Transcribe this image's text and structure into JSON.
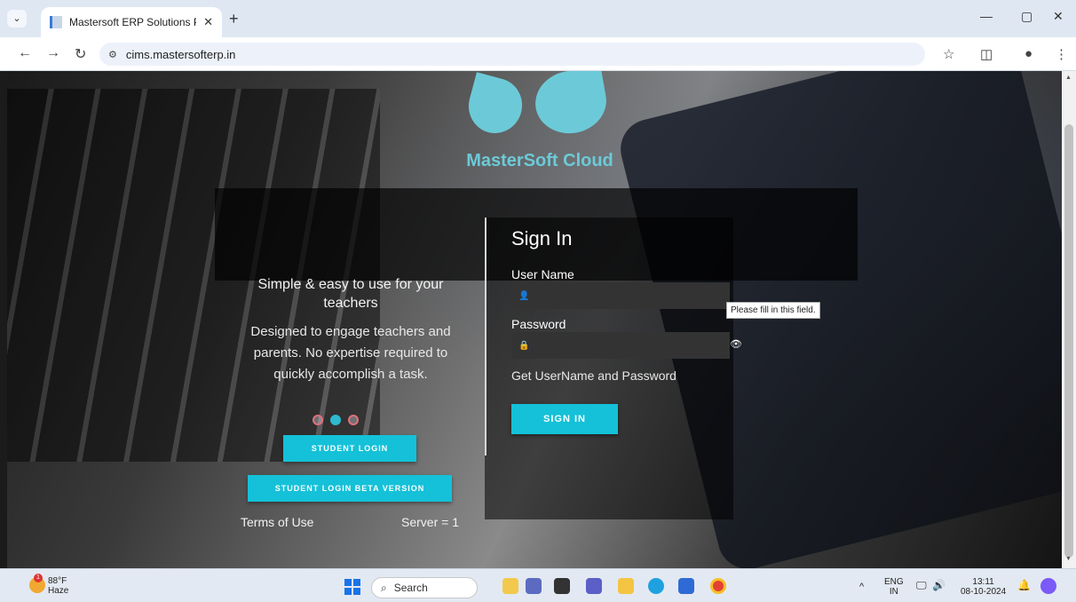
{
  "browser": {
    "tab_title": "Mastersoft ERP Solutions Pvt.Lt",
    "tab_close": "✕",
    "new_tab": "+",
    "url": "cims.mastersofterp.in",
    "minimize": "—",
    "restore": "▢",
    "close": "✕"
  },
  "logo": {
    "text": "MasterSoft Cloud"
  },
  "hero": {
    "headline": "Simple & easy to use for your teachers",
    "subtext": "Designed to engage teachers and parents. No expertise required to quickly accomplish a task."
  },
  "carousel": {
    "dots": 3,
    "active_index": 1
  },
  "buttons": {
    "student_login": "STUDENT LOGIN",
    "student_login_beta": "STUDENT LOGIN BETA VERSION",
    "sign_in": "SIGN IN"
  },
  "footer": {
    "terms": "Terms of Use",
    "server": "Server = 1"
  },
  "signin": {
    "title": "Sign In",
    "username_label": "User Name",
    "password_label": "Password",
    "get_credentials": "Get UserName and Password"
  },
  "tooltip": "Please fill in this field.",
  "taskbar": {
    "temperature": "88°F",
    "condition": "Haze",
    "weather_badge": "1",
    "search_placeholder": "Search",
    "lang_top": "ENG",
    "lang_bottom": "IN",
    "time": "13:11",
    "date": "08-10-2024"
  },
  "colors": {
    "accent": "#14c1d8",
    "logo": "#6ccad8"
  }
}
